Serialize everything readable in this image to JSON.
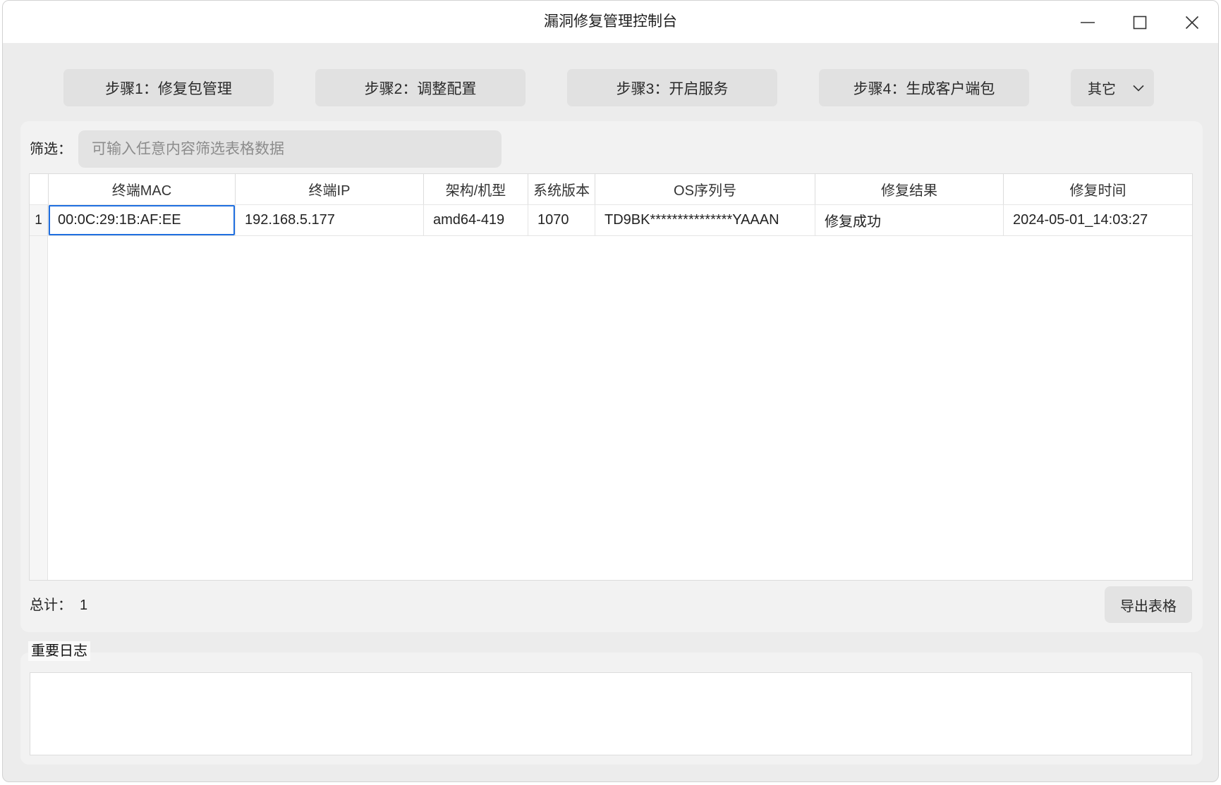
{
  "window": {
    "title": "漏洞修复管理控制台",
    "controls": {
      "minimize_icon": "minimize-icon",
      "maximize_icon": "maximize-icon",
      "close_icon": "close-icon"
    }
  },
  "toolbar": {
    "steps": [
      "步骤1：修复包管理",
      "步骤2：调整配置",
      "步骤3：开启服务",
      "步骤4：生成客户端包"
    ],
    "more": {
      "label": "其它",
      "icon": "chevron-down-icon"
    }
  },
  "filter": {
    "label": "筛选：",
    "placeholder": "可输入任意内容筛选表格数据"
  },
  "table": {
    "columns": [
      "终端MAC",
      "终端IP",
      "架构/机型",
      "系统版本",
      "OS序列号",
      "修复结果",
      "修复时间"
    ],
    "rows": [
      {
        "index": "1",
        "cells": [
          "00:0C:29:1B:AF:EE",
          "192.168.5.177",
          "amd64-419",
          "1070",
          "TD9BK***************YAAAN",
          "修复成功",
          "2024-05-01_14:03:27"
        ]
      }
    ],
    "selected_cell": {
      "row": 0,
      "column": 0
    }
  },
  "summary": {
    "label": "总计：",
    "count": "1"
  },
  "export_button": {
    "label": "导出表格"
  },
  "log": {
    "title": "重要日志"
  },
  "colors": {
    "accent": "#1f6fe0",
    "window_bg": "#ececec",
    "panel_bg": "#f2f2f2",
    "button_bg": "#e1e1e1"
  }
}
